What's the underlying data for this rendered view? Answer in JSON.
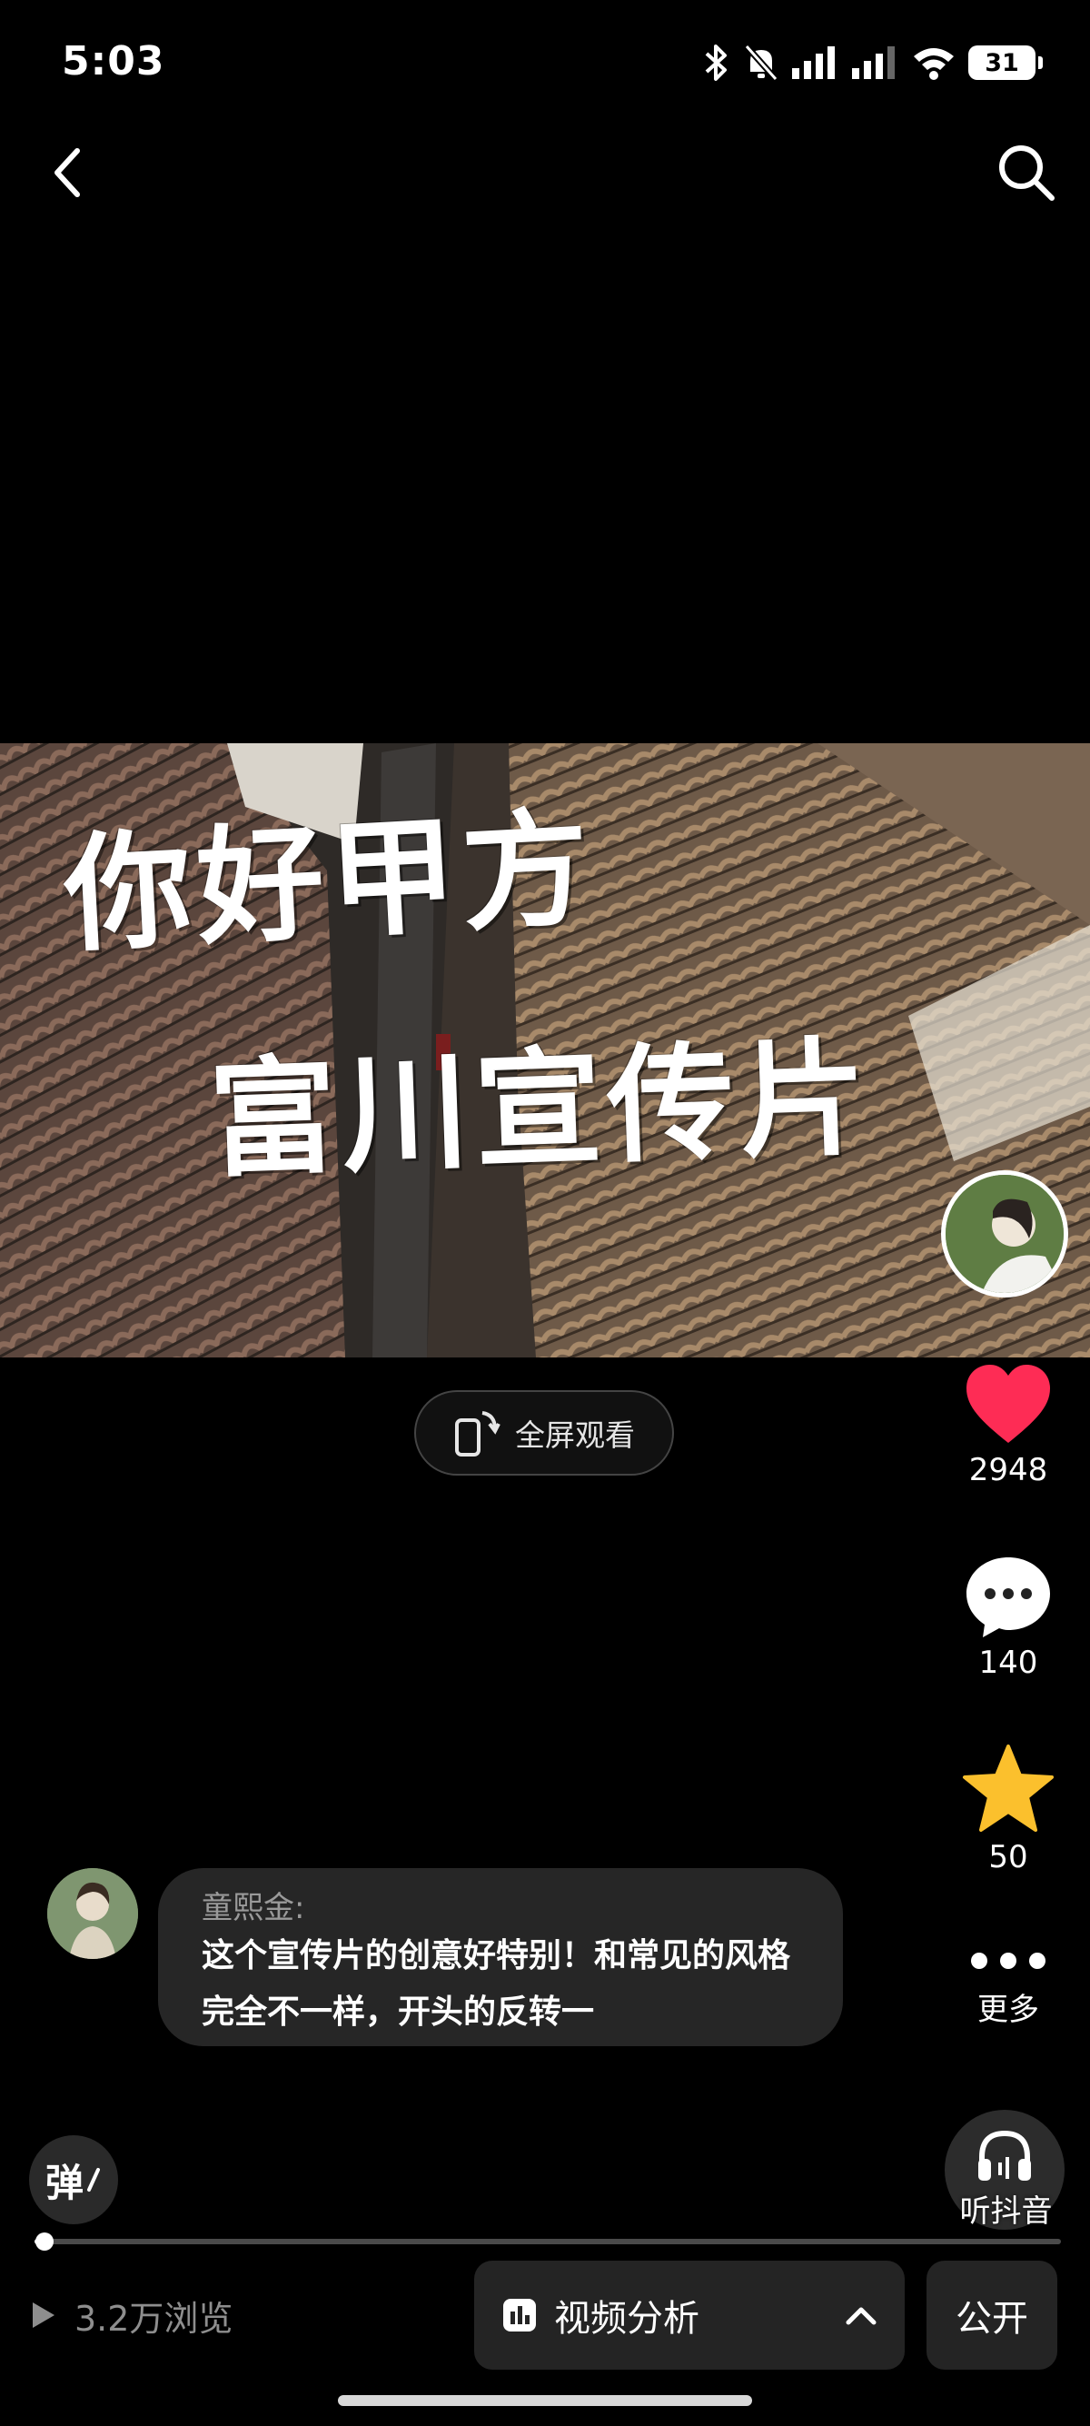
{
  "status_bar": {
    "time": "5:03",
    "battery": "31"
  },
  "video": {
    "title_line1": "你好甲方",
    "title_line2": "富川宣传片"
  },
  "fullscreen": {
    "label": "全屏观看"
  },
  "actions": {
    "likes": "2948",
    "comments": "140",
    "favorites": "50",
    "more_label": "更多",
    "listen_label": "听抖音"
  },
  "comment": {
    "author": "童熙金:",
    "text": "这个宣传片的创意好特别！和常见的风格完全不一样，开头的反转一"
  },
  "danmaku": {
    "label": "弹"
  },
  "progress": {
    "value": 0.01
  },
  "bottom": {
    "views": "3.2万浏览",
    "analysis_label": "视频分析",
    "public_label": "公开"
  },
  "colors": {
    "like": "#fe2c55",
    "favorite": "#fbc02d"
  }
}
